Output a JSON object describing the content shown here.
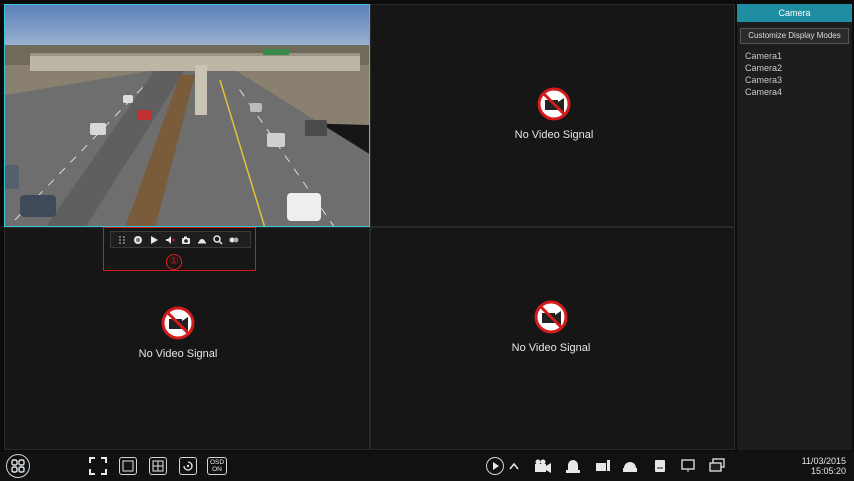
{
  "channels": [
    {
      "id": "ch1",
      "state": "live"
    },
    {
      "id": "ch2",
      "state": "no-signal",
      "text": "No Video Signal"
    },
    {
      "id": "ch3",
      "state": "no-signal",
      "text": "No Video Signal"
    },
    {
      "id": "ch4",
      "state": "no-signal",
      "text": "No Video Signal"
    }
  ],
  "quick_toolbar": {
    "marker": "①",
    "icons": [
      "drag-handle-icon",
      "record-icon",
      "playback-icon",
      "audio-icon",
      "snapshot-icon",
      "ptz-icon",
      "zoom-icon",
      "color-icon"
    ]
  },
  "panel": {
    "title": "Camera",
    "mode_button": "Customize Display Modes",
    "cameras": [
      "Camera1",
      "Camera2",
      "Camera3",
      "Camera4"
    ]
  },
  "bottombar": {
    "osd_line1": "OSD",
    "osd_line2": "ON",
    "date": "11/03/2015",
    "time": "15:05:20"
  },
  "colors": {
    "accent": "#1f8ea3",
    "selected_border": "#34c7d8",
    "highlight": "#d21b1b"
  }
}
